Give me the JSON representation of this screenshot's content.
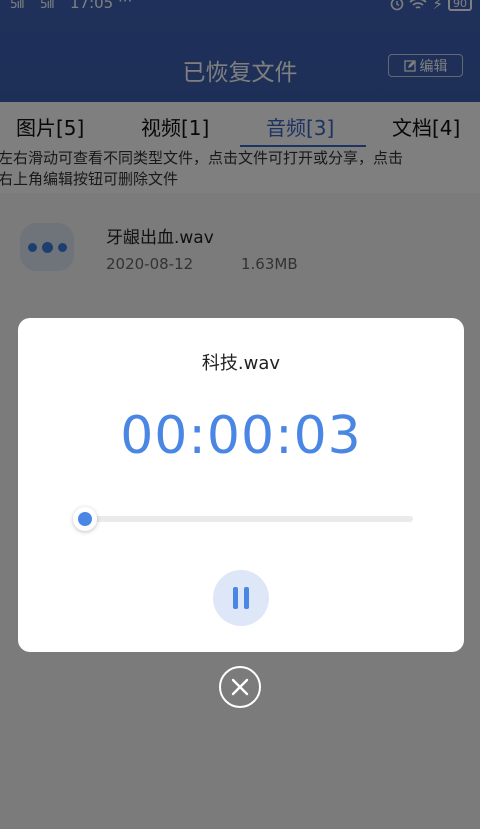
{
  "status_bar": {
    "signal_1": "5ill",
    "signal_2": "5ill",
    "time": "17:05",
    "more": "···",
    "battery": "90"
  },
  "header": {
    "title": "已恢复文件",
    "edit_label": "编辑"
  },
  "tabs": [
    {
      "label": "图片[5]"
    },
    {
      "label": "视频[1]"
    },
    {
      "label": "音频[3]",
      "active": true
    },
    {
      "label": "文档[4]"
    }
  ],
  "hint": {
    "line1": "左右滑动可查看不同类型文件，点击文件可打开或分享，点击",
    "line2": "右上角编辑按钮可删除文件"
  },
  "files": [
    {
      "name": "牙龈出血.wav",
      "date": "2020-08-12",
      "size": "1.63MB"
    }
  ],
  "player": {
    "file_name": "科技.wav",
    "elapsed": "00:00:03",
    "progress": 0.03,
    "state": "playing"
  },
  "colors": {
    "header": "#3f63b4",
    "accent": "#4a86e3",
    "overlay": "rgba(0,0,0,0.5)"
  },
  "icons": [
    "wifi-icon",
    "clock-icon",
    "battery-icon",
    "edit-icon",
    "audio-file-icon",
    "pause-icon",
    "close-icon"
  ]
}
